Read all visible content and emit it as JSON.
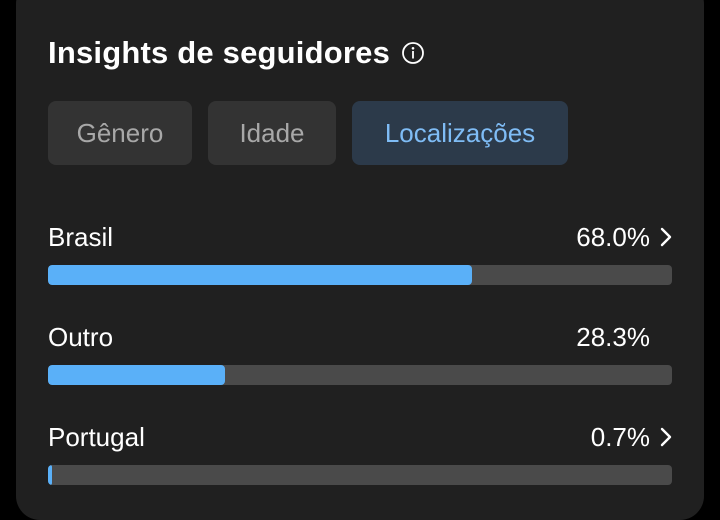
{
  "header": {
    "title": "Insights de seguidores",
    "info_icon": "info-icon"
  },
  "tabs": [
    {
      "label": "Gênero",
      "active": false
    },
    {
      "label": "Idade",
      "active": false
    },
    {
      "label": "Localizações",
      "active": true
    }
  ],
  "locations": [
    {
      "name": "Brasil",
      "percent_label": "68.0%",
      "value": 68.0,
      "has_chevron": true
    },
    {
      "name": "Outro",
      "percent_label": "28.3%",
      "value": 28.3,
      "has_chevron": false
    },
    {
      "name": "Portugal",
      "percent_label": "0.7%",
      "value": 0.7,
      "has_chevron": true
    }
  ],
  "colors": {
    "background": "#000000",
    "card": "#202020",
    "bar_fill": "#5ab0f8",
    "bar_track": "#4a4a4a",
    "active_tab_bg": "#2c3a4a",
    "active_tab_text": "#7fbcf5"
  }
}
